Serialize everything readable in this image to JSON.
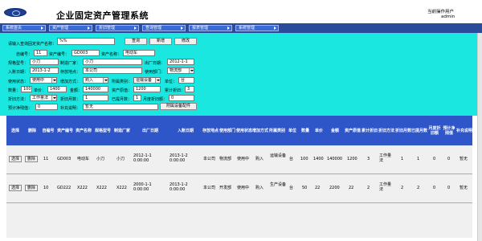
{
  "header": {
    "title": "企业固定资产管理系统",
    "user_label": "当前操作用户",
    "user_name": "admin"
  },
  "nav": [
    {
      "label": "系统首页"
    },
    {
      "label": "资产管理"
    },
    {
      "label": "折旧管理"
    },
    {
      "label": "查询管理"
    },
    {
      "label": "报表管理"
    },
    {
      "label": "系统管理"
    }
  ],
  "search": {
    "label": "请输入查询固定资产名称：",
    "value": "%%",
    "query_label": "查询",
    "new_label": "新增",
    "edit_label": "修改"
  },
  "form": {
    "auto_no_label": "自编号：",
    "auto_no": "11",
    "asset_no_label": "资产编号：",
    "asset_no": "GD003",
    "asset_name_label": "资产名称：",
    "asset_name": "电动车",
    "spec_label": "规格型号：",
    "spec": "小刀",
    "maker_label": "制造厂家：",
    "maker": "小刀",
    "factory_date_label": "出厂日期：",
    "factory_date": "2012-1-1",
    "account_date_label": "入账日期：",
    "account_date": "2013-1-2",
    "location_label": "存放地点：",
    "location": "本公司",
    "dept_label": "使用部门：",
    "dept": "物流部",
    "status_label": "使用状态：",
    "status": "使用中",
    "add_method_label": "增加方式：",
    "add_method": "购入",
    "category_label": "所属类别：",
    "category": "运输设备",
    "unit_label": "单位：",
    "unit": "台",
    "qty_label": "数量：",
    "qty": "100",
    "price_label": "单价：",
    "price": "1400",
    "amount_label": "金额：",
    "amount": "140000",
    "orig_label": "资产原值：",
    "orig": "1200",
    "accum_label": "累计折旧：",
    "accum": "3",
    "dep_method_label": "折旧方法：",
    "dep_method": "工作量法",
    "dep_months_label": "折旧月数：",
    "dep_months": "1",
    "used_months_label": "已提月数：",
    "used_months": "1",
    "monthly_dep_label": "月度折旧额：",
    "monthly_dep": "0",
    "residual_label": "预计净残值：",
    "residual": "0",
    "note_label": "补充说明：",
    "note": "暂无",
    "attach_label": "附属设备配件"
  },
  "table": {
    "headers": [
      "选择",
      "删除",
      "自编号",
      "资产编号",
      "资产名称",
      "规格型号",
      "制造厂家",
      "出厂日期",
      "入账日期",
      "存放地点",
      "使用部门",
      "使用状态",
      "增加方式",
      "所属类别",
      "单位",
      "数量",
      "单价",
      "金额",
      "资产原值",
      "累计折旧",
      "折旧方法",
      "折旧月数",
      "已提月数",
      "月度折旧额",
      "预计净残值",
      "补充说明"
    ],
    "select_label": "选择",
    "delete_label": "删除",
    "rows": [
      {
        "id": "11",
        "no": "GD003",
        "name": "电动车",
        "spec": "小刀",
        "maker": "小刀",
        "factory": "2012-1-1 0:00:00",
        "account": "2013-1-2 0:00:00",
        "location": "本公司",
        "dept": "物流部",
        "status": "使用中",
        "add": "购入",
        "category": "运输设备",
        "unit": "台",
        "qty": "100",
        "price": "1400",
        "amount": "140000",
        "orig": "1200",
        "accum": "3",
        "method": "工作量法",
        "dep_months": "1",
        "used": "1",
        "monthly": "0",
        "residual": "0",
        "note": "暂无"
      },
      {
        "id": "10",
        "no": "GD222",
        "name": "X222",
        "spec": "X222",
        "maker": "X222",
        "factory": "2000-1-1 0:00:00",
        "account": "2013-1-2 0:00:00",
        "location": "本公司",
        "dept": "开发部",
        "status": "使用中",
        "add": "购入",
        "category": "生产设备",
        "unit": "台",
        "qty": "50",
        "price": "22",
        "amount": "2200",
        "orig": "22",
        "accum": "2",
        "method": "工作量法",
        "dep_months": "2",
        "used": "2",
        "monthly": "0",
        "residual": "0",
        "note": "暂无"
      }
    ]
  },
  "colors": {
    "nav_bar": "#2c4a9a",
    "nav_tab": "#3a6ad6",
    "form_bg": "#1ae8e0",
    "table_header": "#2f56c8"
  }
}
